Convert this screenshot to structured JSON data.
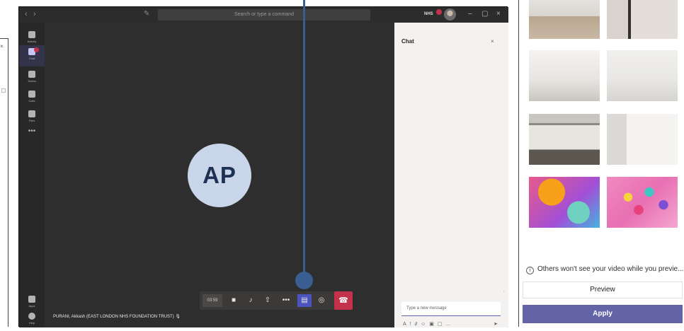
{
  "window": {
    "search_placeholder": "Search or type a command",
    "org_label": "NHS"
  },
  "rail": {
    "items": [
      {
        "label": "Activity",
        "icon": "bell-icon"
      },
      {
        "label": "Chat",
        "icon": "chat-icon"
      },
      {
        "label": "Teams",
        "icon": "teams-icon"
      },
      {
        "label": "Calls",
        "icon": "phone-icon"
      },
      {
        "label": "Files",
        "icon": "file-icon"
      }
    ],
    "more": "•••",
    "bottom": [
      {
        "label": "Apps",
        "icon": "apps-icon"
      },
      {
        "label": "Help",
        "icon": "help-icon"
      }
    ]
  },
  "stage": {
    "initials": "AP",
    "participant": "PURANI, Akkash (EAST LONDON NHS FOUNDATION TRUST)"
  },
  "call_bar": {
    "timer": "03:59"
  },
  "chat": {
    "title": "Chat",
    "placeholder": "Type a new message"
  },
  "background_panel": {
    "notice": "Others won't see your video while you previe...",
    "preview_label": "Preview",
    "apply_label": "Apply"
  },
  "colors": {
    "accent": "#6264a7",
    "hangup": "#c4314b",
    "annotation": "#3a5d92"
  }
}
